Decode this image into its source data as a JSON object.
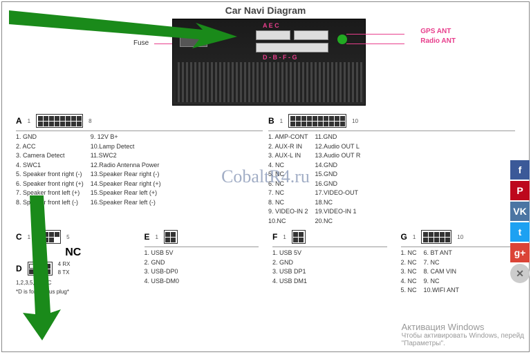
{
  "title": "Car Navi Diagram",
  "labels": {
    "fuse": "Fuse",
    "gps": "GPS ANT",
    "radio": "Radio ANT",
    "top_letters": "A    E    C",
    "bottom_letters": "D - B - F - G"
  },
  "connectors": {
    "A": {
      "layout": [
        8,
        8
      ],
      "corners": [
        "1",
        "8",
        "9",
        "16"
      ]
    },
    "B": {
      "layout": [
        10,
        10
      ],
      "corners": [
        "1",
        "10",
        "11",
        "20"
      ]
    },
    "C": {
      "layout": [
        4,
        3
      ],
      "corners": [
        "1",
        "4",
        "5",
        "7"
      ]
    },
    "D": {
      "layout": [
        4,
        4
      ],
      "corners": [
        "1",
        "",
        "5",
        "8"
      ],
      "extra": [
        "2",
        "3",
        "4 RX",
        "8 TX"
      ]
    },
    "E": {
      "layout": [
        2,
        2
      ],
      "corners": [
        "1",
        "2",
        "3",
        "4"
      ]
    },
    "F": {
      "layout": [
        2,
        2
      ],
      "corners": [
        "1",
        "2",
        "3",
        "4"
      ]
    },
    "G": {
      "layout": [
        5,
        5
      ],
      "corners": [
        "1",
        "5",
        "6",
        "10"
      ]
    }
  },
  "pinsA": {
    "left": [
      "1. GND",
      "2. ACC",
      "3. Camera Detect",
      "4. SWC1",
      "5. Speaker front right (-)",
      "6. Speaker front right (+)",
      "7. Speaker front left (+)",
      "8. Speaker front left (-)"
    ],
    "right": [
      "9. 12V B+",
      "10.Lamp Detect",
      "11.SWC2",
      "12.Radio Antenna Power",
      "13.Speaker Rear right (-)",
      "14.Speaker Rear right (+)",
      "15.Speaker Rear left (+)",
      "16.Speaker Rear left (-)"
    ]
  },
  "pinsB": {
    "left": [
      "1. AMP-CONT",
      "2. AUX-R IN",
      "3. AUX-L IN",
      "4. NC",
      "5. NC",
      "6. NC",
      "7. NC",
      "8. NC",
      "9. VIDEO-IN 2",
      "10.NC"
    ],
    "right": [
      "11.GND",
      "12.Audio OUT L",
      "13.Audio OUT R",
      "14.GND",
      "15.GND",
      "16.GND",
      "17.VIDEO-OUT",
      "18.NC",
      "19.VIDEO-IN 1",
      "20.NC"
    ]
  },
  "pinsD_note": "1,2,3,5,6,7 NC",
  "pinsD_footer": "*D is for canbus plug*",
  "pinsE": [
    "1. USB 5V",
    "2. GND",
    "3. USB-DP0",
    "4. USB-DM0"
  ],
  "pinsF": [
    "1. USB 5V",
    "2. GND",
    "3. USB DP1",
    "4. USB DM1"
  ],
  "pinsG": {
    "left": [
      "1. NC",
      "2. NC",
      "3. NC",
      "4. NC",
      "5. NC"
    ],
    "right": [
      "6. BT ANT",
      "7. NC",
      "8. CAM VIN",
      "9. NC",
      "10.WIFI ANT"
    ]
  },
  "nc_label": "NC",
  "watermark": "CobaltR4.ru",
  "social": [
    "f",
    "P",
    "VK",
    "t",
    "g+",
    "✕"
  ],
  "activation": {
    "line1": "Активация Windows",
    "line2": "Чтобы активировать Windows, перейд",
    "line3": "\"Параметры\"."
  }
}
